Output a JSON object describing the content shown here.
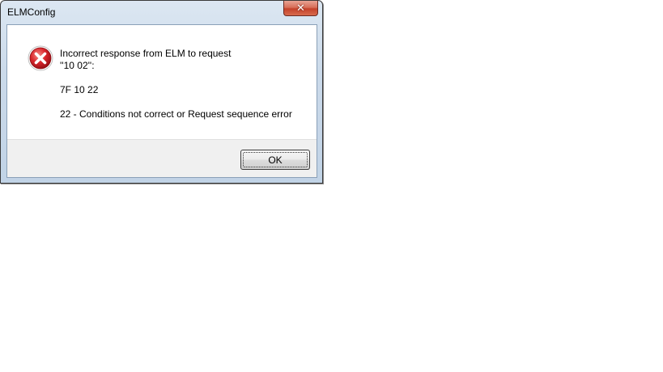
{
  "window": {
    "title": "ELMConfig",
    "close_icon": "close-icon"
  },
  "message": {
    "icon": "error-icon",
    "line1": "Incorrect response from ELM to request",
    "line2": "''10 02'':",
    "line3": "7F 10 22",
    "line4": "22 - Conditions not correct or Request sequence error"
  },
  "footer": {
    "ok_label": "OK"
  },
  "colors": {
    "error_red": "#d8262c",
    "titlebar": "#cbdaea",
    "close_button": "#c4412a"
  }
}
